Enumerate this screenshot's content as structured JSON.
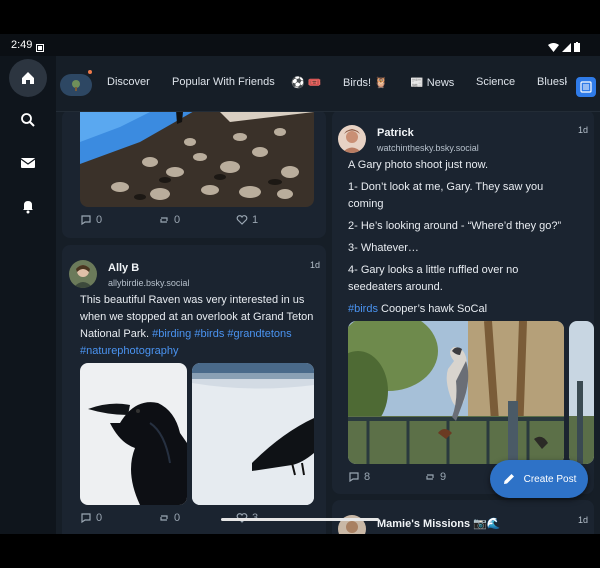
{
  "status": {
    "time": "2:49"
  },
  "tabs": [
    {
      "label": "Discover"
    },
    {
      "label": "Popular With Friends"
    },
    {
      "label": "⚽ 🎟️"
    },
    {
      "label": "Birds! 🦉"
    },
    {
      "label": "📰 News"
    },
    {
      "label": "Science"
    },
    {
      "label": "Bluesk"
    }
  ],
  "cards": {
    "top_left": {
      "reply_count": "0",
      "repost_count": "0",
      "like_count": "1"
    },
    "ally": {
      "name": "Ally B",
      "handle": "allybirdie.bsky.social",
      "age": "1d",
      "text_plain": "This beautiful Raven was very interested in us when we stopped at an overlook at Grand Teton National Park.",
      "tag1": "#birding",
      "tag2": "#birds",
      "tag3": "#grandtetons",
      "tag4": "#naturephotography",
      "reply_count": "0",
      "repost_count": "0",
      "like_count": "3"
    },
    "patrick": {
      "name": "Patrick",
      "handle": "watchinthesky.bsky.social",
      "age": "1d",
      "line1": "A Gary photo shoot just now.",
      "line2": "1- Don’t look at me, Gary. They saw you coming",
      "line3": "2- He’s looking around - “Where’d they go?”",
      "line4": "3- Whatever…",
      "line5": "4- Gary looks a little ruffled over no seedeaters around.",
      "tag": "#birds",
      "line6_rest": " Cooper’s hawk SoCal",
      "reply_count": "8",
      "repost_count": "9"
    },
    "mamie": {
      "name": "Mamie's Missions 📷🌊",
      "age": "1d"
    }
  },
  "fab": {
    "label": "Create Post"
  },
  "colors": {
    "accent": "#2e72c7",
    "link": "#4a93f0",
    "card": "#1b2430",
    "bg": "#161e27"
  }
}
